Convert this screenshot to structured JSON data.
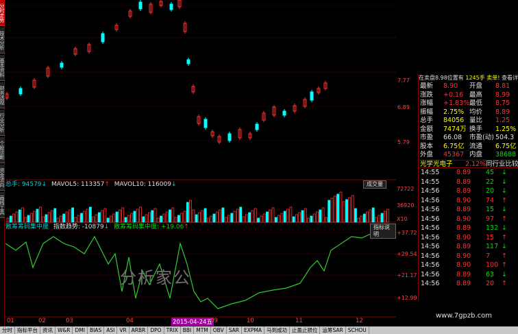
{
  "left_tabs": [
    {
      "label": "分时走势",
      "active": true
    },
    {
      "label": "技术分析",
      "active": false
    },
    {
      "label": "基本资料",
      "active": false
    },
    {
      "label": "财务透视",
      "active": false
    },
    {
      "label": "行业分析",
      "active": false
    },
    {
      "label": "个股诊断",
      "active": false
    },
    {
      "label": "资金流向",
      "active": false
    },
    {
      "label": "画线工具",
      "active": false
    }
  ],
  "main_chart": {
    "y_labels": [
      "6.89",
      "5.79"
    ],
    "price_marker": "7.77"
  },
  "volume_panel": {
    "header": {
      "total": "总手: 94579",
      "total_dir": "↓",
      "mavol5": "MAVOL5: 113357",
      "mavol5_dir": "↑",
      "mavol10": "MAVOL10: 116009",
      "mavol10_dir": "↓"
    },
    "button": "成交量",
    "y_labels": [
      "72722",
      "36920",
      "X10"
    ]
  },
  "indicator_panel": {
    "header": {
      "name": "散筹筹码集中度",
      "trend_label": "指数趋势: -10879",
      "trend_dir": "↓",
      "conc_label": "散筹筹码集中度: +19.06",
      "conc_dir": "↑"
    },
    "button": "指标说明",
    "y_labels": [
      "+37.72",
      "+29.54",
      "+21.17",
      "+12.99"
    ]
  },
  "watermark": "分析家公",
  "date_axis": {
    "labels": [
      "01",
      "02",
      "03",
      "04",
      "2015-04-24五",
      "09",
      "10",
      "11",
      "12"
    ]
  },
  "quote_panel": {
    "top_bar": {
      "text": "在卖盘8.98位置有",
      "qty": "1245手",
      "sell": "卖单!",
      "detail": "查看详细"
    },
    "rows": [
      {
        "k1": "最新",
        "v1": "8.90",
        "k2": "开盘",
        "v2": "8.81",
        "c1": "red",
        "c2": "red"
      },
      {
        "k1": "涨跌",
        "v1": "+0.16",
        "k2": "最高",
        "v2": "8.99",
        "c1": "red",
        "c2": "red"
      },
      {
        "k1": "涨幅",
        "v1": "+1.83%",
        "k2": "最低",
        "v2": "8.75",
        "c1": "red",
        "c2": "red"
      },
      {
        "k1": "振幅",
        "v1": "2.75%",
        "k2": "均价",
        "v2": "8.89",
        "c1": "yel",
        "c2": "red"
      },
      {
        "k1": "总手",
        "v1": "84056",
        "k2": "量比",
        "v2": "1.25",
        "c1": "yel",
        "c2": "red"
      },
      {
        "k1": "金额",
        "v1": "7474万",
        "k2": "换手",
        "v2": "1.25%",
        "c1": "yel",
        "c2": "yel"
      },
      {
        "k1": "市盈",
        "v1": "66.08",
        "k2": "市盈(动)",
        "v2": "504.3",
        "c1": "wht",
        "c2": "wht"
      },
      {
        "k1": "股本",
        "v1": "6.75亿",
        "k2": "流通",
        "v2": "6.75亿",
        "c1": "yel",
        "c2": "yel"
      },
      {
        "k1": "外盘",
        "v1": "45367",
        "k2": "内盘",
        "v2": "38688",
        "c1": "red",
        "c2": "grn"
      }
    ],
    "sector": {
      "name": "光学光电子",
      "change": "2.12%",
      "compare": "同行业比较"
    },
    "ticks": [
      {
        "time": "14:55",
        "price": "8.89",
        "vol": "45",
        "dir": "↓",
        "color": "grn",
        "pcolor": "red"
      },
      {
        "time": "14:55",
        "price": "8.89",
        "vol": "22",
        "dir": "↓",
        "color": "grn",
        "pcolor": "red"
      },
      {
        "time": "14:56",
        "price": "8.89",
        "vol": "20",
        "dir": "↓",
        "color": "grn",
        "pcolor": "red"
      },
      {
        "time": "14:56",
        "price": "8.90",
        "vol": "74",
        "dir": "↑",
        "color": "red",
        "pcolor": "red"
      },
      {
        "time": "14:56",
        "price": "8.89",
        "vol": "15",
        "dir": "↓",
        "color": "grn",
        "pcolor": "red"
      },
      {
        "time": "14:56",
        "price": "8.90",
        "vol": "97",
        "dir": "↑",
        "color": "red",
        "pcolor": "red"
      },
      {
        "time": "14:56",
        "price": "8.89",
        "vol": "132",
        "dir": "↓",
        "color": "grn",
        "pcolor": "red"
      },
      {
        "time": "14:56",
        "price": "8.90",
        "vol": "15",
        "dir": "↑",
        "color": "red",
        "pcolor": "red"
      },
      {
        "time": "14:56",
        "price": "8.89",
        "vol": "117",
        "dir": "↓",
        "color": "grn",
        "pcolor": "red"
      },
      {
        "time": "14:56",
        "price": "8.90",
        "vol": "7",
        "dir": "↑",
        "color": "red",
        "pcolor": "red"
      },
      {
        "time": "14:56",
        "price": "8.90",
        "vol": "100",
        "dir": "↑",
        "color": "red",
        "pcolor": "red"
      },
      {
        "time": "14:56",
        "price": "8.89",
        "vol": "63",
        "dir": "↓",
        "color": "grn",
        "pcolor": "red"
      },
      {
        "time": "14:56",
        "price": "8.89",
        "vol": "20",
        "dir": "↑",
        "color": "red",
        "pcolor": "red"
      }
    ]
  },
  "site_text": "www.7gpzb.com",
  "bottom_tabs": [
    {
      "label": "分时",
      "active": false
    },
    {
      "label": "指标平台",
      "active": false
    },
    {
      "label": "资讯",
      "active": false
    },
    {
      "label": "W&R",
      "active": false
    },
    {
      "label": "DMI",
      "active": false
    },
    {
      "label": "BIAS",
      "active": false
    },
    {
      "label": "ASI",
      "active": false
    },
    {
      "label": "VR",
      "active": false
    },
    {
      "label": "ARBR",
      "active": false
    },
    {
      "label": "DPO",
      "active": false
    },
    {
      "label": "TRIX",
      "active": false
    },
    {
      "label": "BBI",
      "active": false
    },
    {
      "label": "MTM",
      "active": false
    },
    {
      "label": "OBV",
      "active": false
    },
    {
      "label": "SAR",
      "active": false
    },
    {
      "label": "EXPMA",
      "active": false
    },
    {
      "label": "马到成功",
      "active": false
    },
    {
      "label": "止盈止损位",
      "active": false
    },
    {
      "label": "运筹SAR",
      "active": false
    },
    {
      "label": "SCHOU",
      "active": false
    }
  ],
  "colors": {
    "up": "#ff3333",
    "down": "#00ffff",
    "grid": "#800000",
    "ind_line": "#33cc33",
    "accent": "#ffff00"
  }
}
